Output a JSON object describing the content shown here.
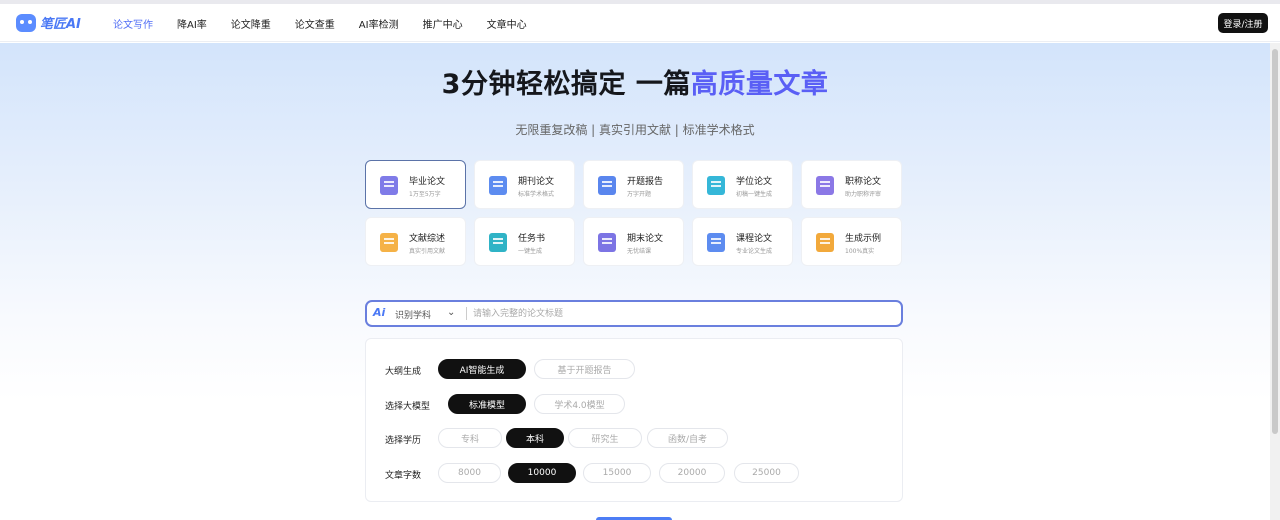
{
  "header": {
    "logo_text": "笔匠AI",
    "nav": [
      {
        "label": "论文写作",
        "active": true
      },
      {
        "label": "降AI率",
        "active": false
      },
      {
        "label": "论文降重",
        "active": false
      },
      {
        "label": "论文查重",
        "active": false
      },
      {
        "label": "AI率检测",
        "active": false
      },
      {
        "label": "推广中心",
        "active": false
      },
      {
        "label": "文章中心",
        "active": false
      }
    ],
    "login_label": "登录/注册"
  },
  "hero": {
    "title_main": "3分钟轻松搞定 一篇",
    "title_highlight": "高质量文章",
    "subtitle": "无限重复改稿 | 真实引用文献 | 标准学术格式"
  },
  "paper_types": [
    {
      "title": "毕业论文",
      "sub": "1万至5万字",
      "icon": "graduation-cap-icon",
      "color": "#7f7be8",
      "active": true
    },
    {
      "title": "期刊论文",
      "sub": "标准学术格式",
      "icon": "journal-icon",
      "color": "#5d8cf0",
      "active": false
    },
    {
      "title": "开题报告",
      "sub": "万字开题",
      "icon": "report-icon",
      "color": "#5a86ee",
      "active": false
    },
    {
      "title": "学位论文",
      "sub": "初稿一键生成",
      "icon": "degree-icon",
      "color": "#35b7d8",
      "active": false
    },
    {
      "title": "职称论文",
      "sub": "助力职称评审",
      "icon": "title-paper-icon",
      "color": "#8b78e6",
      "active": false
    },
    {
      "title": "文献综述",
      "sub": "真实引用文献",
      "icon": "literature-icon",
      "color": "#f5b247",
      "active": false
    },
    {
      "title": "任务书",
      "sub": "一键生成",
      "icon": "task-book-icon",
      "color": "#2fb3c6",
      "active": false
    },
    {
      "title": "期末论文",
      "sub": "无忧结课",
      "icon": "final-paper-icon",
      "color": "#7c74e4",
      "active": false
    },
    {
      "title": "课程论文",
      "sub": "专业论文生成",
      "icon": "course-paper-icon",
      "color": "#5d8cf0",
      "active": false
    },
    {
      "title": "生成示例",
      "sub": "100%真实",
      "icon": "example-icon",
      "color": "#f2a93b",
      "active": false
    }
  ],
  "search": {
    "ai_label": "Ai",
    "subject_label": "识别学科",
    "placeholder": "请输入完整的论文标题"
  },
  "options": {
    "outline": {
      "label": "大纲生成",
      "choices": [
        "AI智能生成",
        "基于开题报告"
      ],
      "selected": "AI智能生成"
    },
    "model": {
      "label": "选择大模型",
      "choices": [
        "标准模型",
        "学术4.0模型"
      ],
      "selected": "标准模型"
    },
    "education": {
      "label": "选择学历",
      "choices": [
        "专科",
        "本科",
        "研究生",
        "函数/自考"
      ],
      "selected": "本科"
    },
    "word_count": {
      "label": "文章字数",
      "choices": [
        "8000",
        "10000",
        "15000",
        "20000",
        "25000"
      ],
      "selected": "10000"
    }
  }
}
